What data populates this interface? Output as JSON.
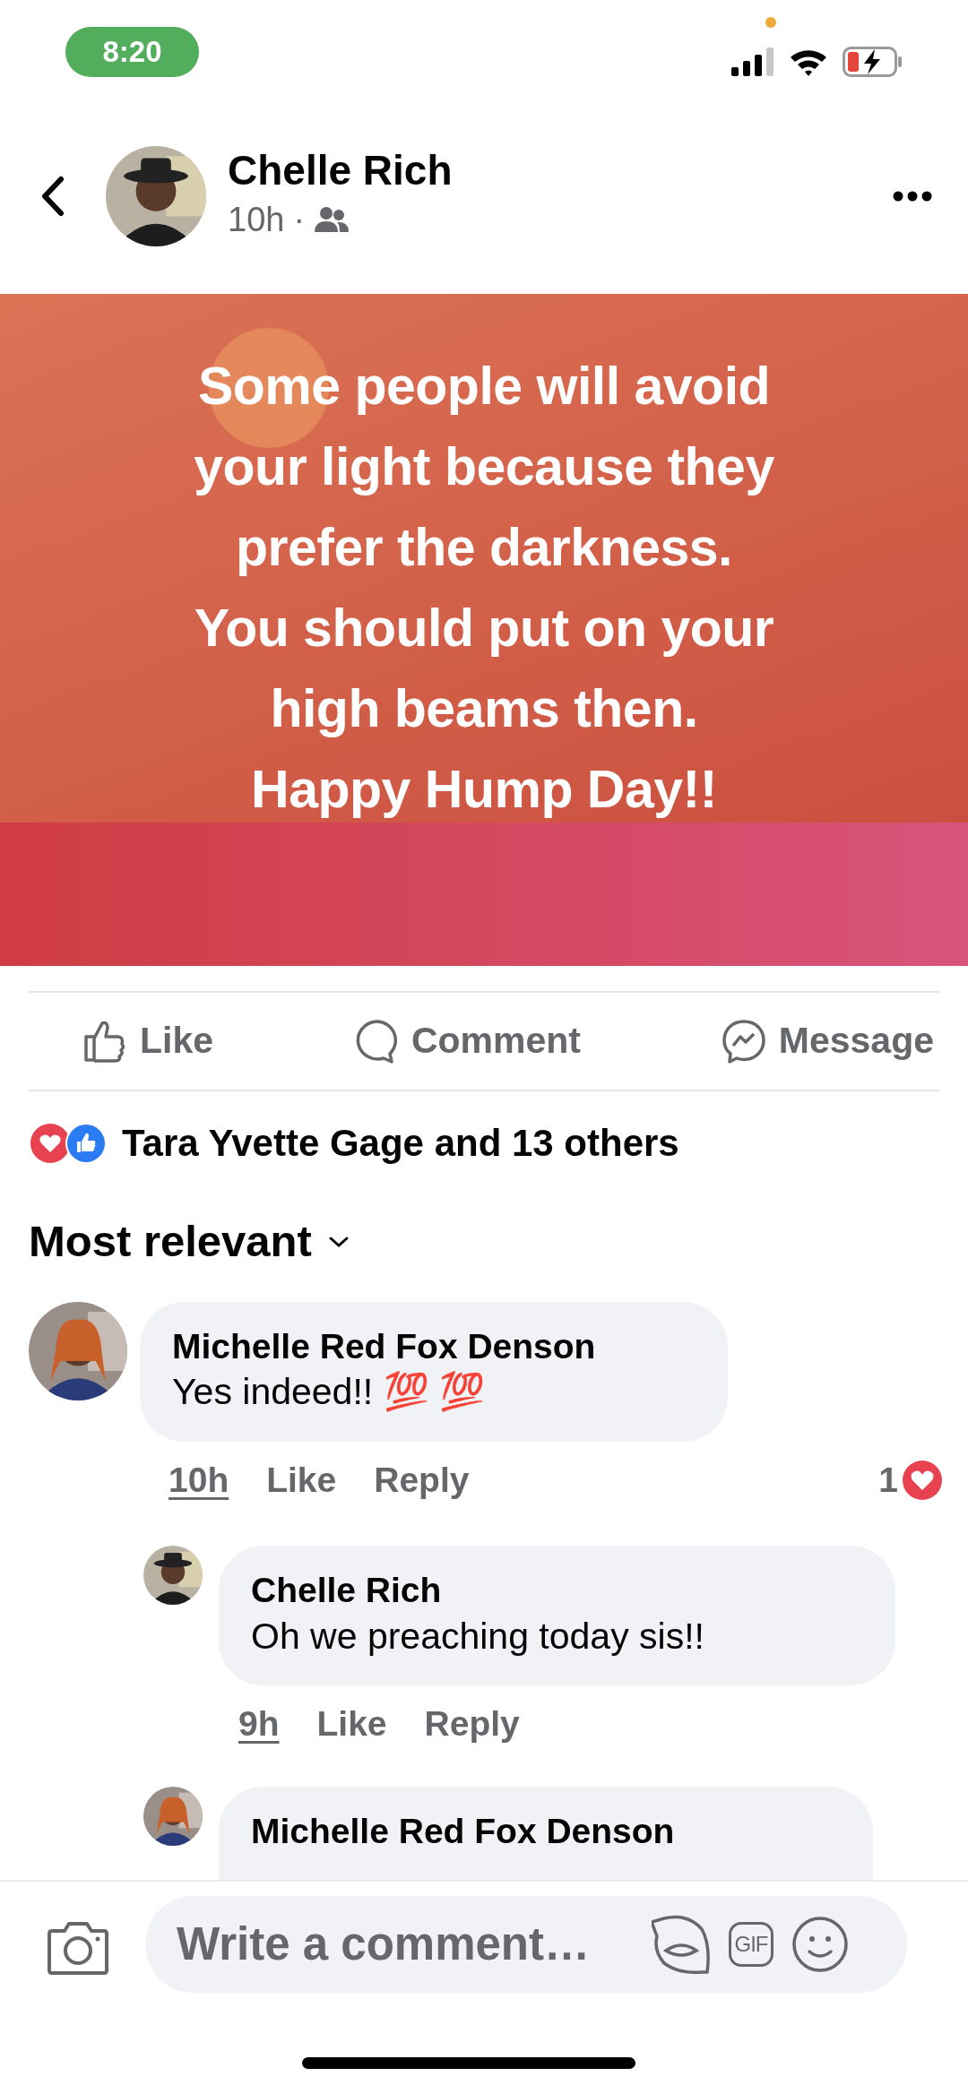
{
  "status_bar": {
    "time": "8:20"
  },
  "post": {
    "author": "Chelle Rich",
    "time": "10h",
    "separator": "·",
    "text": "Some people will avoid\nyour light because they\nprefer the darkness.\nYou should put on your\nhigh beams then.\nHappy Hump Day!!"
  },
  "actions": [
    {
      "kind": "like",
      "label": "Like"
    },
    {
      "kind": "comment",
      "label": "Comment"
    },
    {
      "kind": "message",
      "label": "Message"
    }
  ],
  "reactions": {
    "summary": "Tara Yvette Gage and 13 others"
  },
  "sort": {
    "label": "Most relevant"
  },
  "comments": [
    {
      "author": "Michelle Red Fox Denson",
      "text": "Yes indeed!! 💯 💯",
      "time": "10h",
      "like": "Like",
      "reply": "Reply",
      "reaction_count": "1",
      "children": [
        {
          "author": "Chelle Rich",
          "text": "Oh we preaching today sis!!",
          "time": "9h",
          "like": "Like",
          "reply": "Reply"
        },
        {
          "author": "Michelle Red Fox Denson"
        }
      ]
    }
  ],
  "composer": {
    "placeholder": "Write a comment…",
    "gif_label": "GIF"
  }
}
